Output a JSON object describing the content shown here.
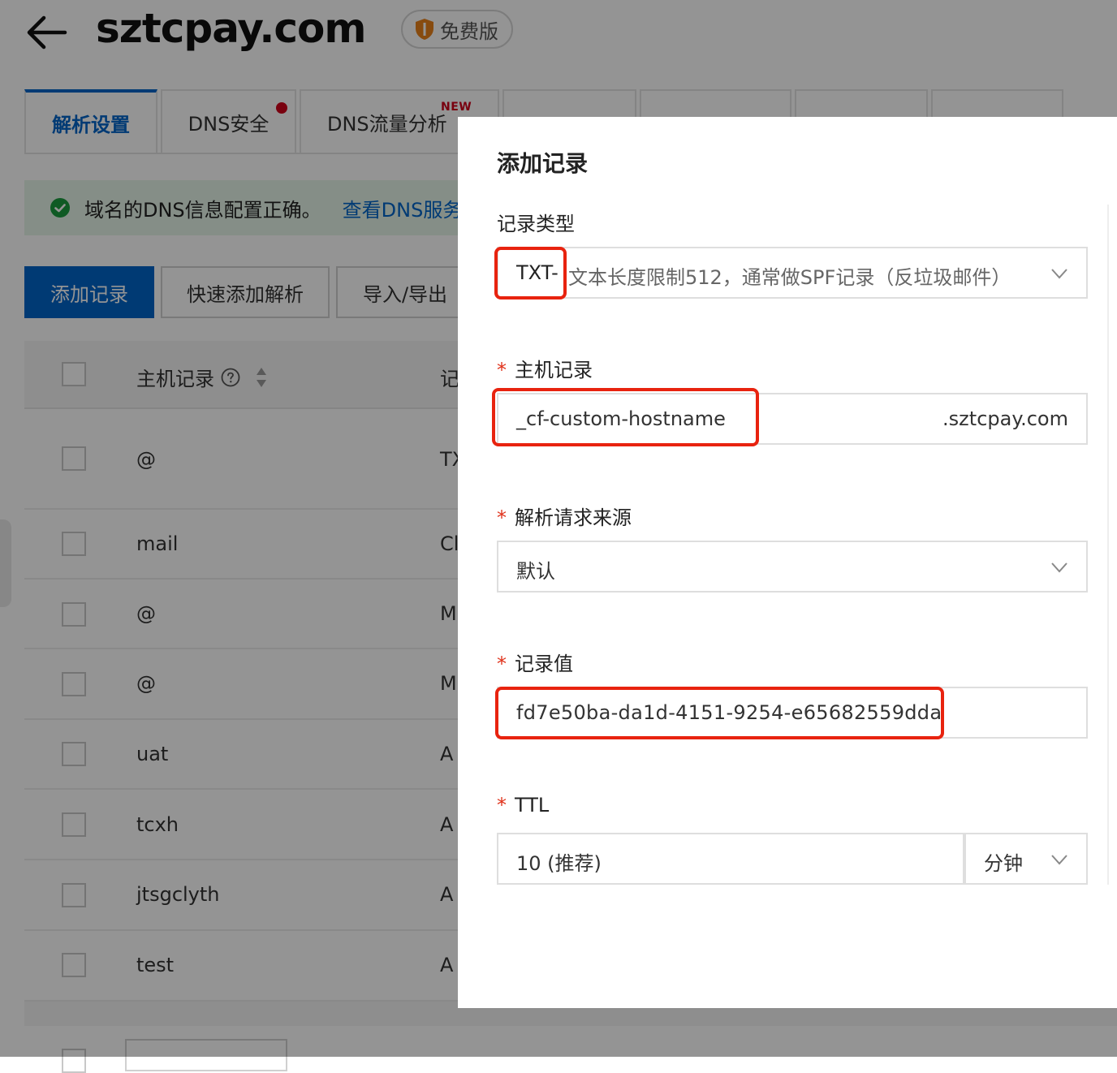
{
  "header": {
    "domain": "sztcpay.com",
    "badge": "免费版"
  },
  "tabs": [
    {
      "label": "解析设置",
      "active": true
    },
    {
      "label": "DNS安全",
      "dot": true
    },
    {
      "label": "DNS流量分析",
      "tag": "NEW"
    }
  ],
  "notice": {
    "message": "域名的DNS信息配置正确。",
    "link": "查看DNS服务"
  },
  "toolbar": {
    "add_record": "添加记录",
    "quick_add": "快速添加解析",
    "import_export": "导入/导出"
  },
  "table": {
    "header_host": "主机记录",
    "header_type": "记",
    "rows": [
      {
        "host": "@",
        "type": "TX"
      },
      {
        "host": "mail",
        "type": "Cl"
      },
      {
        "host": "@",
        "type": "M"
      },
      {
        "host": "@",
        "type": "M"
      },
      {
        "host": "uat",
        "type": "A"
      },
      {
        "host": "tcxh",
        "type": "A"
      },
      {
        "host": "jtsgclyth",
        "type": "A"
      },
      {
        "host": "test",
        "type": "A"
      }
    ]
  },
  "drawer": {
    "title": "添加记录",
    "record_type": {
      "label": "记录类型",
      "value_code": "TXT-",
      "value_desc": "文本长度限制512，通常做SPF记录（反垃圾邮件）"
    },
    "host": {
      "required": "*",
      "label": "主机记录",
      "value": "_cf-custom-hostname",
      "suffix": ".sztcpay.com"
    },
    "source": {
      "required": "*",
      "label": "解析请求来源",
      "value": "默认"
    },
    "record_value": {
      "required": "*",
      "label": "记录值",
      "value": "fd7e50ba-da1d-4151-9254-e65682559dda"
    },
    "ttl": {
      "required": "*",
      "label": "TTL",
      "value": "10 (推荐)",
      "unit": "分钟"
    }
  },
  "colors": {
    "primary": "#0064c8",
    "highlight": "#e8230f",
    "required": "#e0321b",
    "success": "#1a9c3e"
  },
  "icons": [
    "back-arrow-icon",
    "shield-icon",
    "check-circle-icon",
    "question-icon",
    "sort-icon",
    "chevron-down-icon"
  ]
}
